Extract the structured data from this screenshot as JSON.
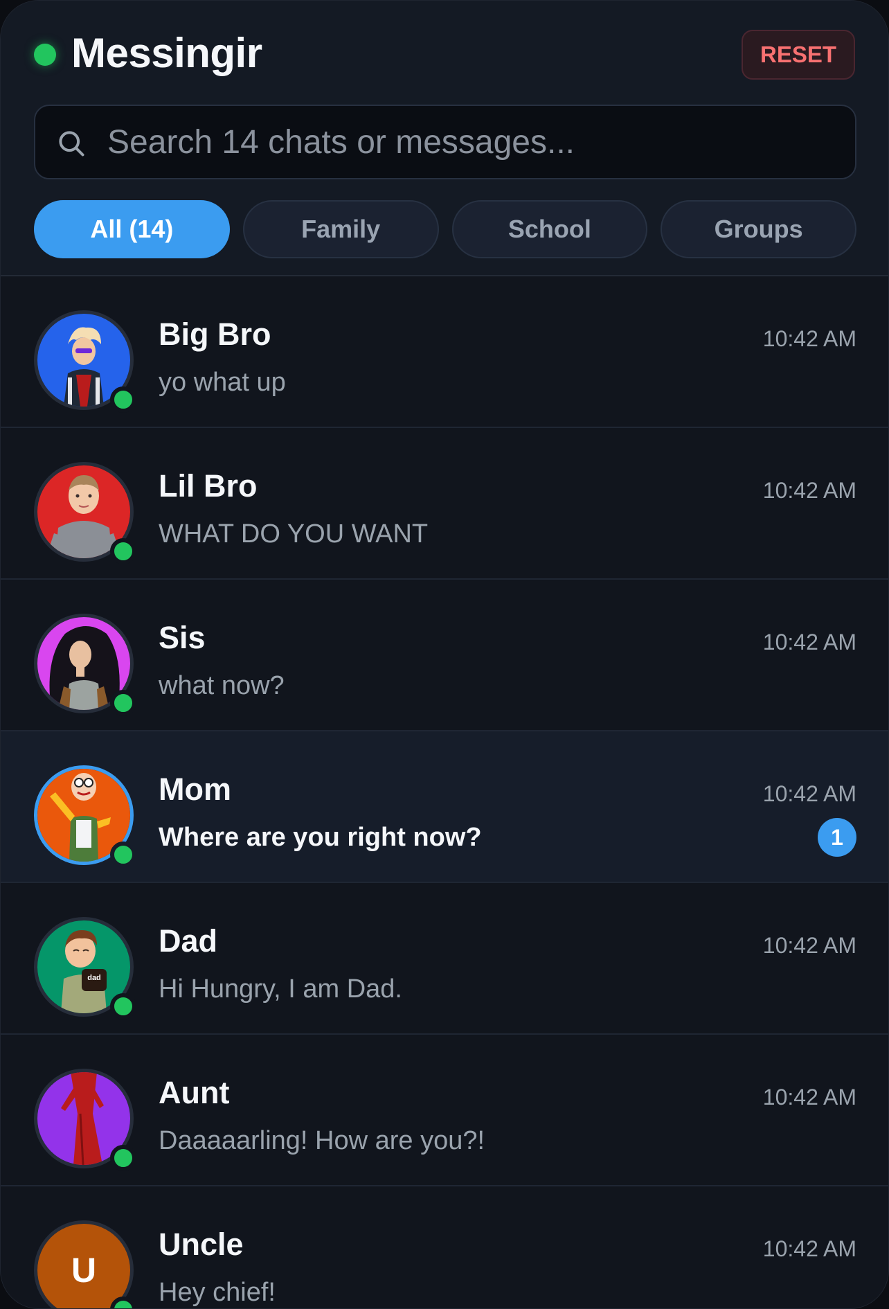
{
  "app": {
    "title": "Messingir",
    "reset_label": "RESET"
  },
  "search": {
    "placeholder": "Search 14 chats or messages..."
  },
  "tabs": [
    {
      "label": "All (14)",
      "active": true
    },
    {
      "label": "Family",
      "active": false
    },
    {
      "label": "School",
      "active": false
    },
    {
      "label": "Groups",
      "active": false
    }
  ],
  "chats": [
    {
      "name": "Big Bro",
      "time": "10:42 AM",
      "preview": "yo what up",
      "online": true,
      "avatar_color": "#2563eb"
    },
    {
      "name": "Lil Bro",
      "time": "10:42 AM",
      "preview": "WHAT DO YOU WANT",
      "online": true,
      "avatar_color": "#dc2626"
    },
    {
      "name": "Sis",
      "time": "10:42 AM",
      "preview": "what now?",
      "online": true,
      "avatar_color": "#d946ef"
    },
    {
      "name": "Mom",
      "time": "10:42 AM",
      "preview": "Where are you right now?",
      "online": true,
      "unread": "1",
      "avatar_color": "#ea580c"
    },
    {
      "name": "Dad",
      "time": "10:42 AM",
      "preview": "Hi Hungry, I am Dad.",
      "online": true,
      "avatar_color": "#059669"
    },
    {
      "name": "Aunt",
      "time": "10:42 AM",
      "preview": "Daaaaarling! How are you?!",
      "online": true,
      "avatar_color": "#9333ea"
    },
    {
      "name": "Uncle",
      "time": "10:42 AM",
      "preview": "Hey chief!",
      "online": true,
      "initial": "U",
      "avatar_color": "#b45309"
    }
  ],
  "colors": {
    "accent": "#3b9cf0",
    "online": "#22c55e",
    "danger": "#f87171"
  }
}
